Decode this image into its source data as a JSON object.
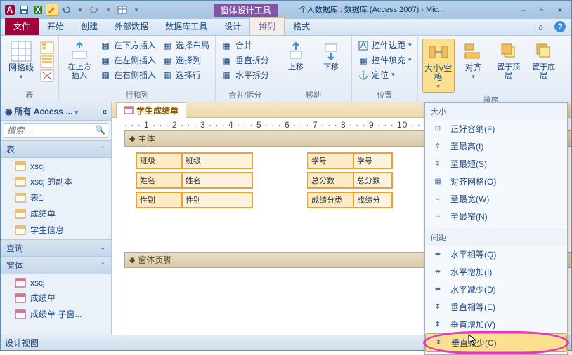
{
  "title": {
    "tool": "窗体设计工具",
    "doc": "个人数据库 : 数据库 (Access 2007) - Mic..."
  },
  "tabs": {
    "file": "文件",
    "home": "开始",
    "create": "创建",
    "external": "外部数据",
    "dbtools": "数据库工具",
    "design": "设计",
    "arrange": "排列",
    "format": "格式"
  },
  "ribbon": {
    "g_table": "表",
    "g_rowcol": "行和列",
    "g_mergesplit": "合并/拆分",
    "g_move": "移动",
    "g_position": "位置",
    "g_sizespace": "大小/空格",
    "g_align": "对齐",
    "g_order": "排序",
    "gridlines": "网格线",
    "ins_above": "在上方插入",
    "ins_below": "在下方插入",
    "ins_left": "在左侧插入",
    "ins_right": "在右侧插入",
    "sel_layout": "选择布局",
    "sel_row": "选择列",
    "sel_col": "选择行",
    "merge": "合并",
    "vsplit": "垂直拆分",
    "hsplit": "水平拆分",
    "move_up": "上移",
    "move_down": "下移",
    "ctl_margin": "控件边距",
    "ctl_pad": "控件填充",
    "anchor": "定位",
    "size_space": "大小/空格",
    "align": "对齐",
    "bring_front": "置于顶层",
    "send_back": "置于底层"
  },
  "nav": {
    "header": "所有 Access ...",
    "search_ph": "搜索...",
    "grp_tables": "表",
    "grp_queries": "查询",
    "grp_forms": "窗体",
    "t1": "xscj",
    "t2": "xscj 的副本",
    "t3": "表1",
    "t4": "成绩单",
    "t5": "学生信息",
    "f1": "xscj",
    "f2": "成绩单",
    "f3": "成绩单 子窗..."
  },
  "doc": {
    "tab": "学生成绩单",
    "sec_body": "主体",
    "sec_footer": "窗体页脚"
  },
  "fields": {
    "class_l": "班级",
    "class_c": "班级",
    "id_l": "学号",
    "id_c": "学号",
    "name_l": "姓名",
    "name_c": "姓名",
    "total_l": "总分数",
    "total_c": "总分数",
    "sex_l": "性别",
    "sex_c": "性别",
    "cat_l": "成绩分类",
    "cat_c": "成绩分"
  },
  "menu": {
    "sec_size": "大小",
    "sec_spacing": "间距",
    "fit": "正好容纳(F)",
    "tallest": "至最高(I)",
    "shortest": "至最短(S)",
    "grid": "对齐网格(O)",
    "widest": "至最宽(W)",
    "narrowest": "至最窄(N)",
    "h_equal": "水平相等(Q)",
    "h_inc": "水平增加(I)",
    "h_dec": "水平减少(D)",
    "v_equal": "垂直相等(E)",
    "v_inc": "垂直增加(V)",
    "v_dec": "垂直减少(C)"
  },
  "status": "设计视图"
}
